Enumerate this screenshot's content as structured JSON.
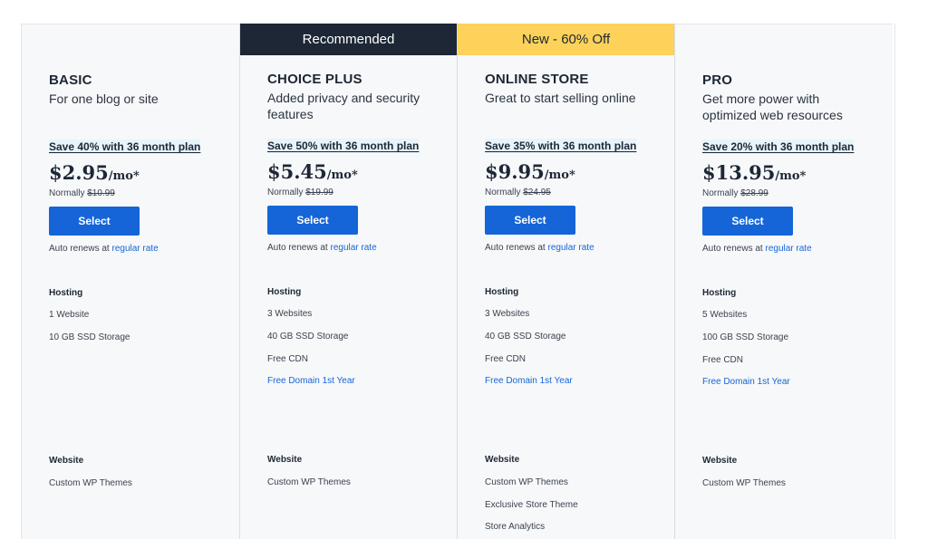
{
  "plans": [
    {
      "banner": "",
      "name": "BASIC",
      "description": "For one blog or site",
      "save_text": "Save 40% with 36 month plan",
      "price": "$2.95",
      "price_suffix": "/mo*",
      "normally_label": "Normally",
      "normally_price": "$10.99",
      "select_label": "Select",
      "renew_text": "Auto renews at",
      "renew_link": "regular rate",
      "hosting_title": "Hosting",
      "hosting": [
        "1 Website",
        "10 GB SSD Storage"
      ],
      "website_title": "Website",
      "website": [
        "Custom WP Themes"
      ]
    },
    {
      "banner": "Recommended",
      "name": "CHOICE PLUS",
      "description": "Added privacy and security features",
      "save_text": "Save 50% with 36 month plan",
      "price": "$5.45",
      "price_suffix": "/mo*",
      "normally_label": "Normally",
      "normally_price": "$19.99",
      "select_label": "Select",
      "renew_text": "Auto renews at",
      "renew_link": "regular rate",
      "hosting_title": "Hosting",
      "hosting": [
        "3 Websites",
        "40 GB SSD Storage",
        "Free CDN",
        "Free Domain 1st Year"
      ],
      "website_title": "Website",
      "website": [
        "Custom WP Themes"
      ]
    },
    {
      "banner": "New - 60% Off",
      "name": "ONLINE STORE",
      "description": "Great to start selling online",
      "save_text": "Save 35% with 36 month plan",
      "price": "$9.95",
      "price_suffix": "/mo*",
      "normally_label": "Normally",
      "normally_price": "$24.95",
      "select_label": "Select",
      "renew_text": "Auto renews at",
      "renew_link": "regular rate",
      "hosting_title": "Hosting",
      "hosting": [
        "3 Websites",
        "40 GB SSD Storage",
        "Free CDN",
        "Free Domain 1st Year"
      ],
      "website_title": "Website",
      "website": [
        "Custom WP Themes",
        "Exclusive Store Theme",
        "Store Analytics"
      ]
    },
    {
      "banner": "",
      "name": "PRO",
      "description": "Get more power with optimized web resources",
      "save_text": "Save 20% with 36 month plan",
      "price": "$13.95",
      "price_suffix": "/mo*",
      "normally_label": "Normally",
      "normally_price": "$28.99",
      "select_label": "Select",
      "renew_text": "Auto renews at",
      "renew_link": "regular rate",
      "hosting_title": "Hosting",
      "hosting": [
        "5 Websites",
        "100 GB SSD Storage",
        "Free CDN",
        "Free Domain 1st Year"
      ],
      "website_title": "Website",
      "website": [
        "Custom WP Themes"
      ]
    }
  ],
  "colors": {
    "accent_blue": "#1565d8",
    "banner_dark": "#1d2735",
    "banner_yellow": "#fdd25a"
  }
}
